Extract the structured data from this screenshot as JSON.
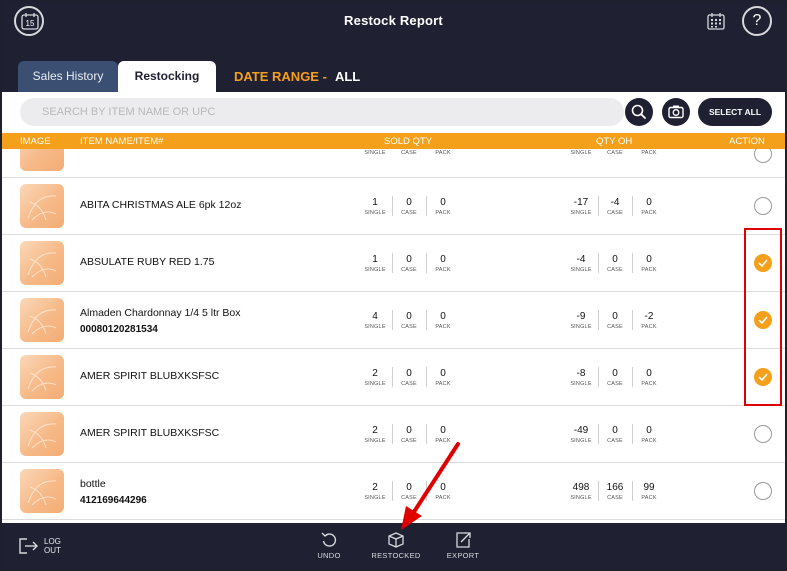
{
  "header": {
    "title": "Restock Report",
    "calendar_day": "15",
    "help_glyph": "?"
  },
  "tabs": {
    "sales_history": "Sales History",
    "restocking": "Restocking"
  },
  "date_range": {
    "label": "DATE RANGE -",
    "value": "ALL"
  },
  "search": {
    "placeholder": "SEARCH BY ITEM NAME OR UPC",
    "select_all_label": "SELECT ALL"
  },
  "columns": {
    "image": "IMAGE",
    "item": "ITEM NAME/ITEM#",
    "sold_qty": "SOLD QTY",
    "qty_oh": "QTY OH",
    "action": "ACTION"
  },
  "qty_labels": {
    "single": "SINGLE",
    "case": "CASE",
    "pack": "PACK"
  },
  "rows": [
    {
      "name": "ABITA CHRISTMAS  ALE 6pk 12oz",
      "upc": "",
      "sold": [
        "1",
        "0",
        "0"
      ],
      "oh": [
        "-17",
        "-4",
        "0"
      ],
      "selected": false
    },
    {
      "name": "ABSULATE RUBY RED 1.75",
      "upc": "",
      "sold": [
        "1",
        "0",
        "0"
      ],
      "oh": [
        "-4",
        "0",
        "0"
      ],
      "selected": true
    },
    {
      "name": "Almaden Chardonnay 1/4 5 ltr Box",
      "upc": "00080120281534",
      "sold": [
        "4",
        "0",
        "0"
      ],
      "oh": [
        "-9",
        "0",
        "-2"
      ],
      "selected": true
    },
    {
      "name": "AMER SPIRIT BLUBXKSFSC",
      "upc": "",
      "sold": [
        "2",
        "0",
        "0"
      ],
      "oh": [
        "-8",
        "0",
        "0"
      ],
      "selected": true
    },
    {
      "name": "AMER SPIRIT BLUBXKSFSC",
      "upc": "",
      "sold": [
        "2",
        "0",
        "0"
      ],
      "oh": [
        "-49",
        "0",
        "0"
      ],
      "selected": false
    },
    {
      "name": "bottle",
      "upc": "412169644296",
      "sold": [
        "2",
        "0",
        "0"
      ],
      "oh": [
        "498",
        "166",
        "99"
      ],
      "selected": false
    }
  ],
  "footer": {
    "logout_line1": "LOG",
    "logout_line2": "OUT",
    "undo": "UNDO",
    "restocked": "RESTOCKED",
    "export": "EXPORT"
  },
  "colors": {
    "header_bg": "#1f2133",
    "accent_orange": "#f5a01a",
    "tab_inactive": "#3b4f72",
    "annotation_red": "#e00000"
  },
  "icons": {
    "left_calendar": "calendar-15-icon",
    "right_calendar": "calendar-grid-icon",
    "help": "help-icon",
    "search": "search-icon",
    "camera": "camera-icon",
    "undo": "undo-icon",
    "restocked": "box-icon",
    "export": "export-icon",
    "logout": "logout-icon",
    "checked": "checkmark-icon"
  }
}
